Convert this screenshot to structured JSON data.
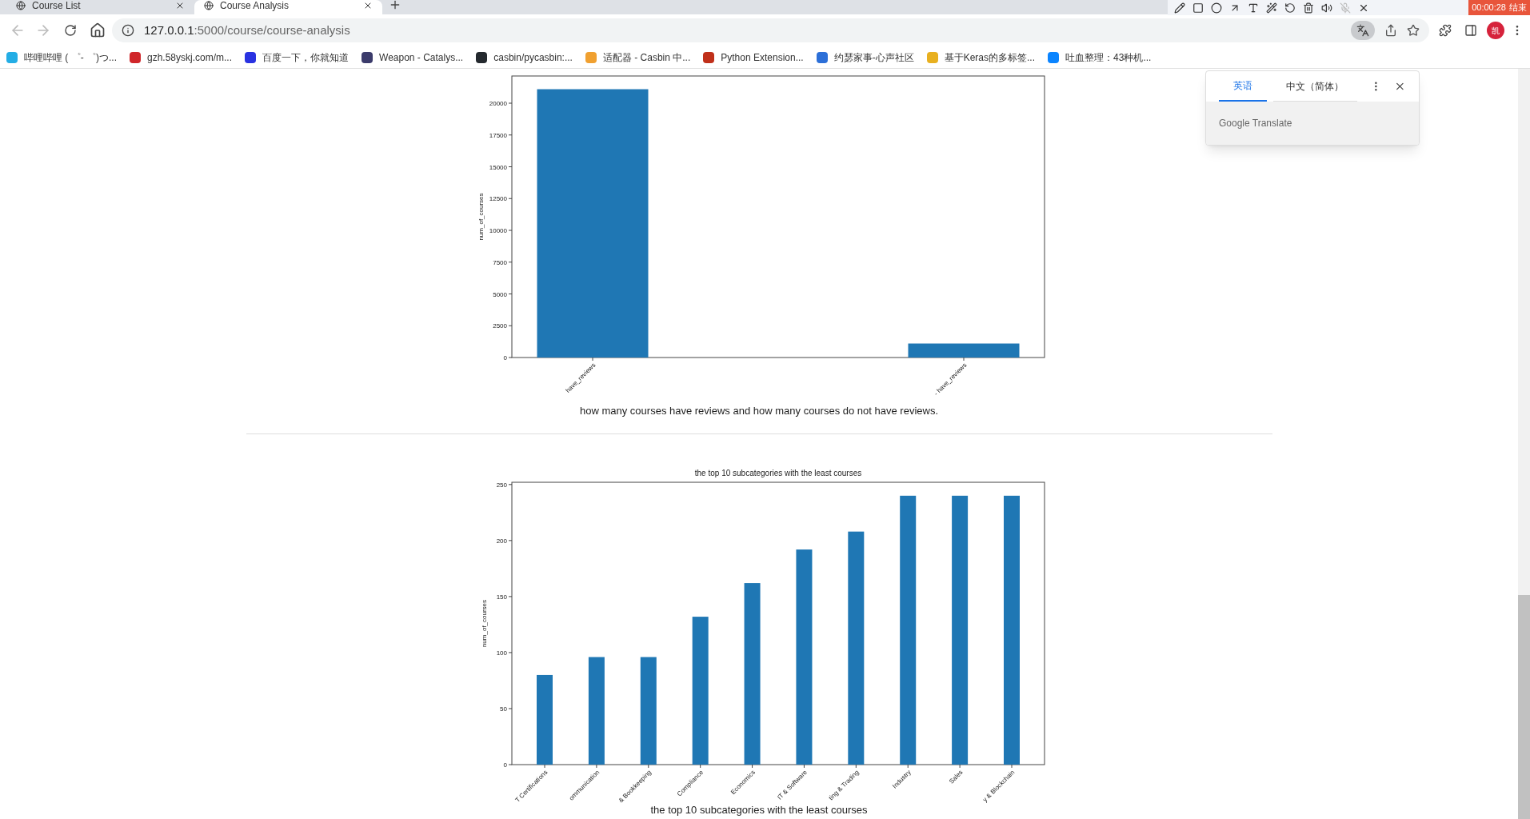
{
  "tabs": [
    {
      "title": "Course List",
      "selected": false
    },
    {
      "title": "Course Analysis",
      "selected": true
    }
  ],
  "address": {
    "host": "127.0.0.1",
    "rest": ":5000/course/course-analysis"
  },
  "bookmarks": [
    {
      "label": "哔哩哔哩 ( ゜- ゜)つ...",
      "color": "#23ade5"
    },
    {
      "label": "gzh.58yskj.com/m...",
      "color": "#d0262a"
    },
    {
      "label": "百度一下，你就知道",
      "color": "#2932e1"
    },
    {
      "label": "Weapon - Catalys...",
      "color": "#3b3b6b"
    },
    {
      "label": "casbin/pycasbin:...",
      "color": "#24292e"
    },
    {
      "label": "适配器 - Casbin 中...",
      "color": "#f0a030"
    },
    {
      "label": "Python Extension...",
      "color": "#c0301a"
    },
    {
      "label": "约瑟家事-心声社区",
      "color": "#2c6fd8"
    },
    {
      "label": "基于Keras的多标签...",
      "color": "#e8b020"
    },
    {
      "label": "吐血整理：43种机...",
      "color": "#0a84ff"
    }
  ],
  "profile": {
    "initial": "凯"
  },
  "recorder": {
    "time": "00:00:28",
    "stop": "结束"
  },
  "translate_popup": {
    "languages": [
      {
        "label": "英语",
        "selected": true
      },
      {
        "label": "中文（简体）",
        "selected": false
      }
    ],
    "footer": "Google Translate"
  },
  "sections": [
    {
      "caption": "how many courses have reviews and how many courses do not have reviews.",
      "chart_data": {
        "type": "bar",
        "ylabel": "num_of_courses",
        "categories": [
          "have_reviews",
          "- have_reviews"
        ],
        "values": [
          21100,
          1100
        ],
        "ylim": [
          0,
          22140
        ],
        "yticks": [
          0,
          2500,
          5000,
          7500,
          10000,
          12500,
          15000,
          17500,
          20000
        ]
      }
    },
    {
      "caption": "the top 10 subcategories with the least courses",
      "chart_data": {
        "type": "bar",
        "title": "the top 10 subcategories with the least courses",
        "ylabel": "num_of_courses",
        "categories": [
          "T Certifications",
          "ommunication",
          "& Bookkeeping",
          "Compliance",
          "Economics",
          "IT & Software",
          "ting & Trading",
          "Industry",
          "Sales",
          "y & Blockchain"
        ],
        "values": [
          80,
          96,
          96,
          132,
          162,
          192,
          208,
          240,
          240,
          240
        ],
        "ylim": [
          0,
          252
        ],
        "yticks": [
          0,
          50,
          100,
          150,
          200,
          250
        ]
      }
    }
  ]
}
